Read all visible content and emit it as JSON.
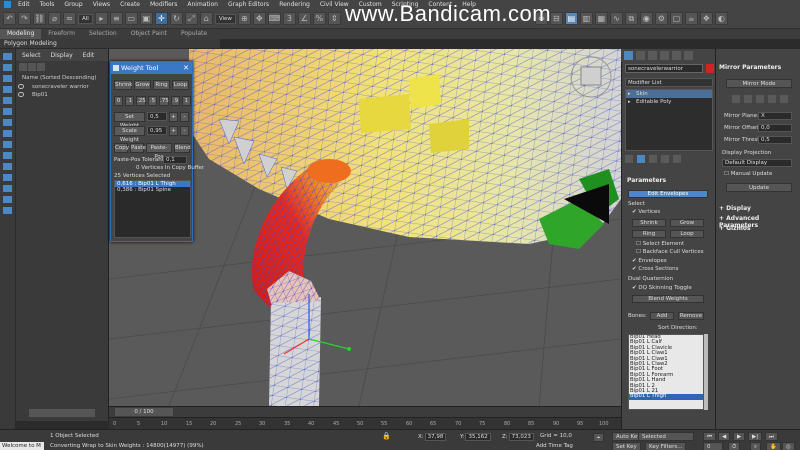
{
  "menu": {
    "items": [
      "Edit",
      "Tools",
      "Group",
      "Views",
      "Create",
      "Modifiers",
      "Animation",
      "Graph Editors",
      "Rendering",
      "Civil View",
      "Custom",
      "Scripting",
      "Content",
      "Help"
    ]
  },
  "watermark": "www.Bandicam.com",
  "toolbar": {
    "selection_filter": "All",
    "view_dropdown": "View"
  },
  "ribbon": {
    "tabs": [
      "Modeling",
      "Freeform",
      "Selection",
      "Object Paint",
      "Populate"
    ],
    "subtitle": "Polygon Modeling"
  },
  "scene_explorer": {
    "menu": [
      "Select",
      "Display",
      "Edit"
    ],
    "column_header": "Name (Sorted Descending)",
    "rows": [
      "sonecraveler warrior",
      "Bip01"
    ]
  },
  "weight_tool": {
    "title": "Weight Tool",
    "row1": [
      "Shrink",
      "Grow",
      "Ring",
      "Loop"
    ],
    "row2": [
      "0",
      ".1",
      ".25",
      ".5",
      ".75",
      ".9",
      "1"
    ],
    "set_weight_label": "Set Weight",
    "set_weight_value": "0,5",
    "scale_weight_label": "Scale Weight",
    "scale_weight_value": "0,95",
    "row3": [
      "Copy",
      "Paste",
      "Paste-Pos",
      "Blend"
    ],
    "paste_tol_label": "Paste-Pos Tolerance:",
    "paste_tol_value": "0,1",
    "buffer_text": "0 Vertices In Copy Buffer",
    "selected_text": "25 Vertices Selected",
    "weights": [
      "0,616 : Bip01 L Thigh",
      "0,386 : Bip01 Spine"
    ]
  },
  "command_panel": {
    "object_name": "sonecravelerwarrior",
    "modifier_list": "Modifier List",
    "stack": [
      "Skin",
      "Editable Poly"
    ],
    "params_title": "Parameters",
    "edit_envelopes": "Edit Envelopes",
    "select_label": "Select",
    "vertices": "Vertices",
    "btns_a": [
      "Shrink",
      "Grow"
    ],
    "btns_b": [
      "Ring",
      "Loop"
    ],
    "select_element": "Select Element",
    "backface": "Backface Cull Vertices",
    "envelopes": "Envelopes",
    "cross_sections": "Cross Sections",
    "dual_quaternion": "Dual Quaternion",
    "dq_toggle": "DQ Skinning Toggle",
    "blend_weights": "Blend Weights",
    "bones_label": "Bones:",
    "add": "Add",
    "remove": "Remove",
    "sort_direction": "Sort Direction:",
    "bones": [
      "Bip01 Head",
      "Bip01 L Calf",
      "Bip01 L Clavicle",
      "Bip01 L Claw1",
      "Bip01 L Claw1",
      "Bip01 L Claw2",
      "Bip01 L Foot",
      "Bip01 L Forearm",
      "Bip01 L Hand",
      "Bip01 L 2",
      "Bip01 L 21",
      "Bip01 L Thigh"
    ]
  },
  "mirror_panel": {
    "title": "Mirror Parameters",
    "mirror_mode": "Mirror Mode",
    "mirror_plane_label": "Mirror Plane:",
    "mirror_plane_value": "X",
    "mirror_offset_label": "Mirror Offset:",
    "mirror_offset_value": "0,0",
    "mirror_thresh_label": "Mirror Thresh.:",
    "mirror_thresh_value": "0,5",
    "display_projection": "Display Projection",
    "default_display": "Default Display",
    "manual_update": "Manual Update",
    "update": "Update",
    "rollouts": [
      "Display",
      "Advanced Parameters",
      "Gizmos"
    ]
  },
  "timeline": {
    "slider": "0 / 100",
    "ticks": [
      "0",
      "5",
      "10",
      "15",
      "20",
      "25",
      "30",
      "35",
      "40",
      "45",
      "50",
      "55",
      "60",
      "65",
      "70",
      "75",
      "80",
      "85",
      "90",
      "95",
      "100"
    ]
  },
  "status": {
    "welcome": "Welcome to M",
    "selected": "1 Object Selected",
    "message": "Converting Wrap to Skin Weights : 14800(14977) (99%)",
    "x_label": "X:",
    "x_value": "37,98",
    "y_label": "Y:",
    "y_value": "35,162",
    "z_label": "Z:",
    "z_value": "73,023",
    "grid": "Grid = 10,0",
    "add_time_tag": "Add Time Tag",
    "auto_key": "Auto Key",
    "set_key": "Set Key",
    "selected_dd": "Selected",
    "key_filters": "Key Filters...",
    "frame": "0"
  }
}
